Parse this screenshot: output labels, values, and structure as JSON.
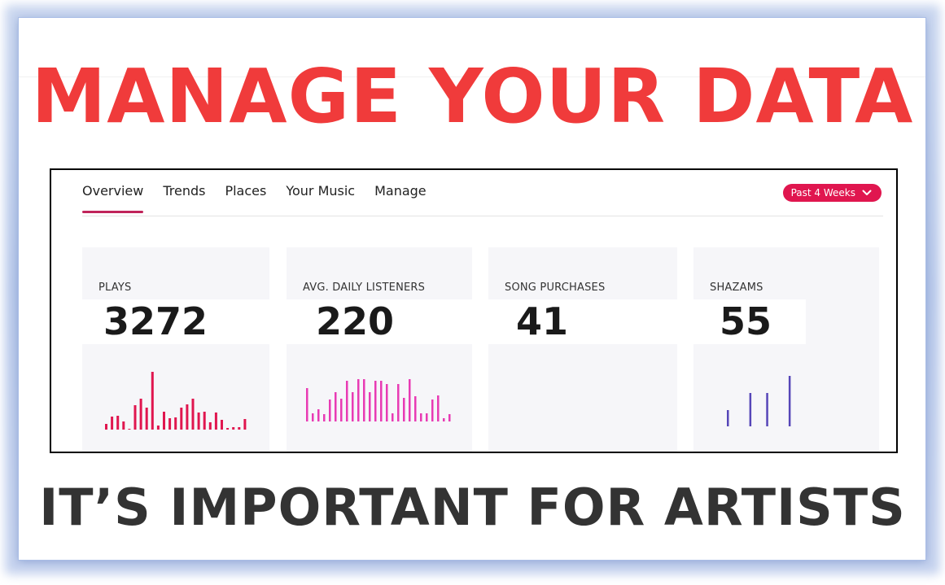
{
  "headline": "MANAGE YOUR DATA",
  "subline": "IT’S IMPORTANT FOR ARTISTS",
  "dashboard": {
    "tabs": [
      {
        "label": "Overview",
        "active": true
      },
      {
        "label": "Trends",
        "active": false
      },
      {
        "label": "Places",
        "active": false
      },
      {
        "label": "Your Music",
        "active": false
      },
      {
        "label": "Manage",
        "active": false
      }
    ],
    "range_selector": {
      "label": "Past 4 Weeks",
      "icon": "chevron-down-icon",
      "color": "#e0164f"
    },
    "cards": [
      {
        "label": "PLAYS",
        "value": "3272",
        "bar_color": "#e0164f",
        "bars": [
          7,
          16,
          17,
          10,
          1,
          30,
          38,
          27,
          71,
          5,
          22,
          14,
          15,
          27,
          31,
          38,
          21,
          22,
          9,
          21,
          12,
          2,
          3,
          3,
          13
        ]
      },
      {
        "label": "AVG. DAILY LISTENERS",
        "value": "220",
        "bar_color": "#e83bb4",
        "bars": [
          41,
          10,
          15,
          9,
          27,
          36,
          28,
          50,
          36,
          52,
          52,
          36,
          50,
          50,
          46,
          10,
          46,
          29,
          52,
          31,
          10,
          10,
          27,
          32,
          4,
          9
        ]
      },
      {
        "label": "SONG PURCHASES",
        "value": "41",
        "bar_color": "#e0164f",
        "bars": []
      },
      {
        "label": "SHAZAMS",
        "value": "55",
        "bar_color": "#5646b8",
        "bars": [
          20,
          0,
          0,
          0,
          41,
          0,
          0,
          41,
          0,
          0,
          0,
          62
        ]
      }
    ]
  },
  "chart_data": [
    {
      "type": "bar",
      "title": "PLAYS",
      "values": [
        7,
        16,
        17,
        10,
        1,
        30,
        38,
        27,
        71,
        5,
        22,
        14,
        15,
        27,
        31,
        38,
        21,
        22,
        9,
        21,
        12,
        2,
        3,
        3,
        13
      ],
      "xlabel": "",
      "ylabel": "",
      "grid": false
    },
    {
      "type": "bar",
      "title": "AVG. DAILY LISTENERS",
      "values": [
        41,
        10,
        15,
        9,
        27,
        36,
        28,
        50,
        36,
        52,
        52,
        36,
        50,
        50,
        46,
        10,
        46,
        29,
        52,
        31,
        10,
        10,
        27,
        32,
        4,
        9
      ],
      "xlabel": "",
      "ylabel": "",
      "grid": false
    },
    {
      "type": "bar",
      "title": "SHAZAMS",
      "values": [
        20,
        0,
        0,
        0,
        41,
        0,
        0,
        41,
        0,
        0,
        0,
        62
      ],
      "xlabel": "",
      "ylabel": "",
      "grid": false
    }
  ]
}
